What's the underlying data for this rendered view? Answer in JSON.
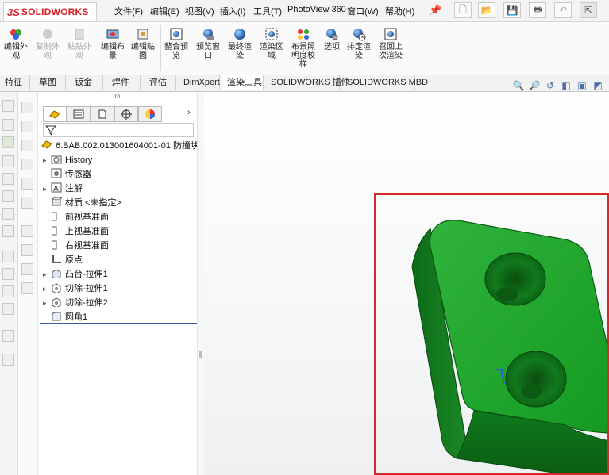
{
  "app": {
    "brand_prefix": "3S",
    "brand_name": "SOLIDWORKS"
  },
  "menu": [
    "文件(F)",
    "编辑(E)",
    "视图(V)",
    "插入(I)",
    "工具(T)",
    "PhotoView 360",
    "窗口(W)",
    "帮助(H)"
  ],
  "ribbon": [
    {
      "label": "编辑外\n观",
      "icon": "edit-appearance-icon"
    },
    {
      "label": "复制外\n观",
      "icon": "copy-appearance-icon",
      "disabled": true
    },
    {
      "label": "粘贴外\n观",
      "icon": "paste-appearance-icon",
      "disabled": true
    },
    {
      "label": "编辑布\n景",
      "icon": "edit-scene-icon"
    },
    {
      "label": "编辑贴\n图",
      "icon": "edit-decal-icon"
    },
    {
      "label": "整合预\n览",
      "icon": "integrated-preview-icon"
    },
    {
      "label": "预览窗\n口",
      "icon": "preview-window-icon"
    },
    {
      "label": "最终渲\n染",
      "icon": "final-render-icon"
    },
    {
      "label": "渲染区\n域",
      "icon": "render-region-icon"
    },
    {
      "label": "布景照\n明度校\n样",
      "icon": "scene-illumination-icon"
    },
    {
      "label": "选项",
      "icon": "options-icon"
    },
    {
      "label": "排定渲\n染",
      "icon": "schedule-render-icon"
    },
    {
      "label": "召回上\n次渲染",
      "icon": "recall-last-render-icon"
    }
  ],
  "tabs": [
    "特征",
    "草图",
    "钣金",
    "焊件",
    "评估",
    "DimXpert",
    "渲染工具",
    "SOLIDWORKS 插件",
    "SOLIDWORKS MBD"
  ],
  "active_tab": "渲染工具",
  "tree": {
    "root": "6.BAB.002.013001604001-01 防撞块  (",
    "items": [
      {
        "label": "History",
        "icon": "history-folder-icon",
        "expand": true
      },
      {
        "label": "传感器",
        "icon": "sensor-icon",
        "expand": false
      },
      {
        "label": "注解",
        "icon": "annotation-icon",
        "expand": true
      },
      {
        "label": "材质 <未指定>",
        "icon": "material-icon",
        "expand": false
      },
      {
        "label": "前视基准面",
        "icon": "plane-icon",
        "expand": false
      },
      {
        "label": "上视基准面",
        "icon": "plane-icon",
        "expand": false
      },
      {
        "label": "右视基准面",
        "icon": "plane-icon",
        "expand": false
      },
      {
        "label": "原点",
        "icon": "origin-icon",
        "expand": false
      },
      {
        "label": "凸台-拉伸1",
        "icon": "boss-extrude-icon",
        "expand": true
      },
      {
        "label": "切除-拉伸1",
        "icon": "cut-extrude-icon",
        "expand": true
      },
      {
        "label": "切除-拉伸2",
        "icon": "cut-extrude-icon",
        "expand": true
      },
      {
        "label": "圆角1",
        "icon": "fillet-icon",
        "expand": false
      }
    ]
  },
  "colors": {
    "part_green": "#1a9c2a",
    "part_dark": "#0d6a18",
    "highlight_red": "#d42a2a",
    "accent_blue": "#3b5f9e"
  }
}
